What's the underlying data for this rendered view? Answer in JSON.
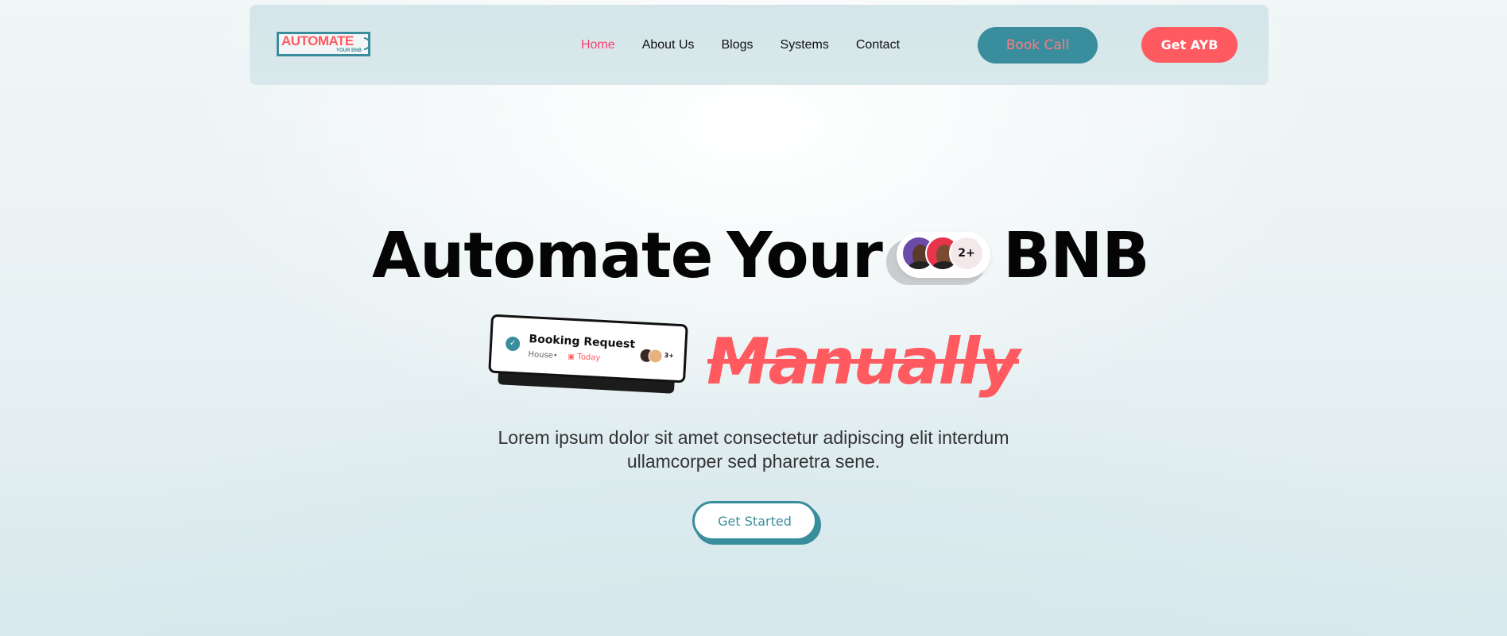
{
  "brand": {
    "logo_text": "AUTOMATE",
    "logo_subtext": "YOUR BNB"
  },
  "nav": {
    "items": [
      {
        "label": "Home",
        "active": true
      },
      {
        "label": "About Us",
        "active": false
      },
      {
        "label": "Blogs",
        "active": false
      },
      {
        "label": "Systems",
        "active": false
      },
      {
        "label": "Contact",
        "active": false
      }
    ],
    "book_call_label": "Book Call",
    "get_ayb_label": "Get AYB"
  },
  "hero": {
    "headline_word1": "Automate",
    "headline_word2": "Your",
    "headline_word3": "BNB",
    "avatar_count": "2+",
    "strikethrough_word": "Manually",
    "subtext": "Lorem ipsum dolor sit amet consectetur adipiscing elit interdum ullamcorper sed pharetra sene.",
    "cta_label": "Get Started"
  },
  "booking_card": {
    "title": "Booking Request",
    "house": "House•",
    "date": "Today",
    "avatar_count": "3+"
  },
  "colors": {
    "teal": "#3a8d9c",
    "coral": "#ff5a5f",
    "active_link": "#ff3d6e"
  }
}
